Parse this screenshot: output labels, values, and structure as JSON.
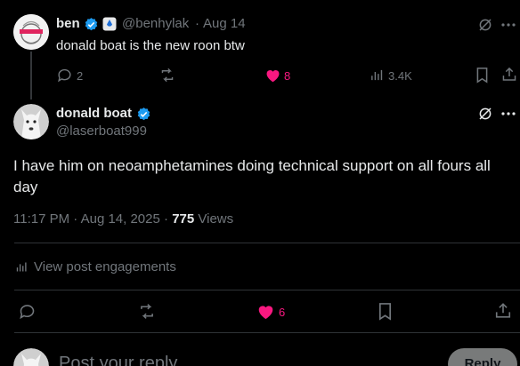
{
  "first_post": {
    "author_name": "ben",
    "handle": "@benhylak",
    "dot": "·",
    "date": "Aug 14",
    "text": "donald boat is the new roon btw",
    "replies": "2",
    "likes": "8",
    "views": "3.4K"
  },
  "main_post": {
    "author_name": "donald boat",
    "handle": "@laserboat999",
    "text": "I have him on neoamphetamines doing technical support on all fours all day",
    "time": "11:17 PM · Aug 14, 2025 ·",
    "views_count": "775",
    "views_label": "Views",
    "engagements_label": "View post engagements",
    "likes": "6"
  },
  "composer": {
    "placeholder": "Post your reply",
    "reply_label": "Reply"
  },
  "colors": {
    "background": "#000000",
    "verified_blue": "#1d9bf0",
    "like_pink": "#f91880",
    "muted": "#71767b"
  }
}
